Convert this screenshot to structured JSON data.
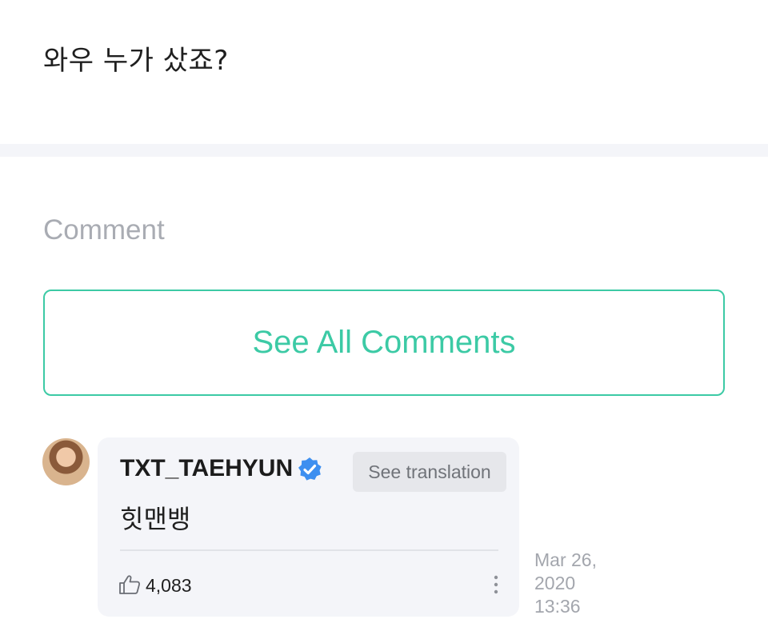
{
  "post": {
    "text": "와우 누가 샀죠?"
  },
  "comments_section": {
    "label": "Comment",
    "see_all_label": "See All Comments"
  },
  "comment": {
    "author": "TXT_TAEHYUN",
    "verified_icon": "verified-badge-icon",
    "translate_label": "See translation",
    "body": "힛맨뱅",
    "like_icon": "thumbs-up-icon",
    "like_count": "4,083",
    "more_icon": "more-vertical-icon",
    "timestamp_line1": "Mar 26,",
    "timestamp_line2": "2020",
    "timestamp_line3": "13:36"
  },
  "colors": {
    "accent": "#3ccaa5",
    "verified": "#3d8ff0",
    "card_bg": "#f4f5f9",
    "muted_text": "#a3a6ad"
  }
}
